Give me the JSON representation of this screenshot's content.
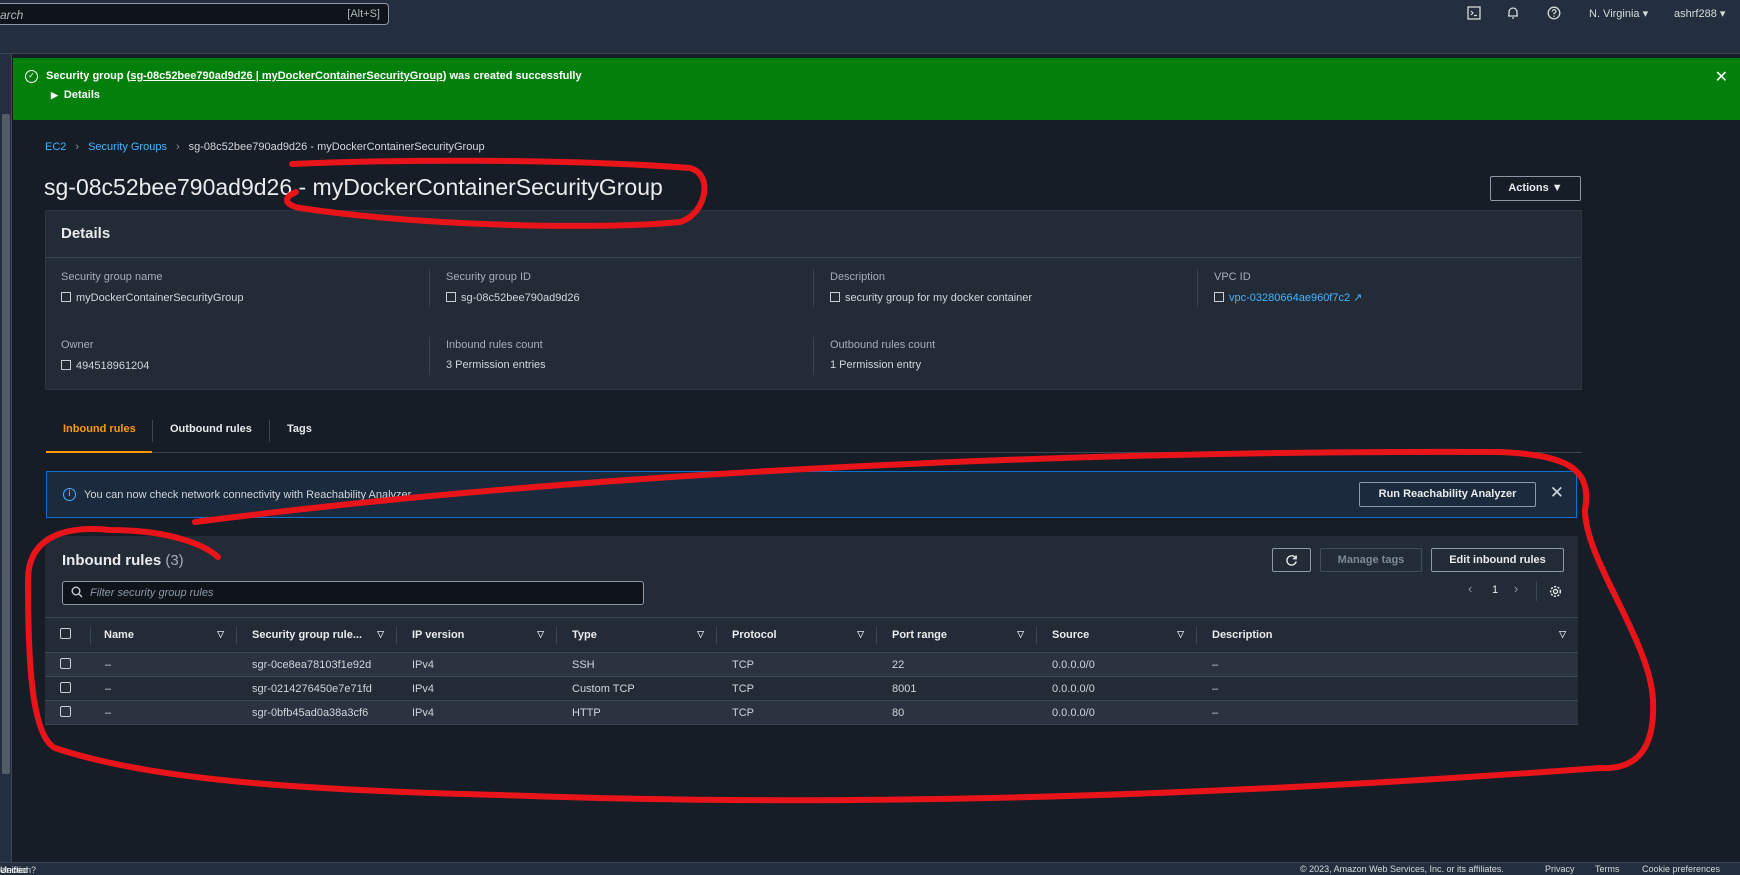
{
  "topnav": {
    "search_placeholder": "arch",
    "search_shortcut": "[Alt+S]",
    "region": "N. Virginia",
    "user": "ashrf288"
  },
  "flash": {
    "prefix": "Security group (",
    "link": "sg-08c52bee790ad9d26 | myDockerContainerSecurityGroup",
    "suffix": ") was created successfully",
    "details_label": "Details"
  },
  "breadcrumb": {
    "items": [
      "EC2",
      "Security Groups",
      "sg-08c52bee790ad9d26 - myDockerContainerSecurityGroup"
    ]
  },
  "page": {
    "title": "sg-08c52bee790ad9d26 - myDockerContainerSecurityGroup",
    "actions_label": "Actions"
  },
  "details": {
    "title": "Details",
    "fields": [
      {
        "label": "Security group name",
        "value": "myDockerContainerSecurityGroup"
      },
      {
        "label": "Security group ID",
        "value": "sg-08c52bee790ad9d26"
      },
      {
        "label": "Description",
        "value": "security group for my docker container"
      },
      {
        "label": "VPC ID",
        "value": "vpc-03280664ae960f7c2"
      },
      {
        "label": "Owner",
        "value": "494518961204"
      },
      {
        "label": "Inbound rules count",
        "value": "3 Permission entries"
      },
      {
        "label": "Outbound rules count",
        "value": "1 Permission entry"
      }
    ]
  },
  "tabs": [
    "Inbound rules",
    "Outbound rules",
    "Tags"
  ],
  "info_banner": {
    "text": "You can now check network connectivity with Reachability Analyzer",
    "button": "Run Reachability Analyzer"
  },
  "inbound": {
    "title": "Inbound rules",
    "count": "(3)",
    "manage_tags": "Manage tags",
    "edit": "Edit inbound rules",
    "filter_placeholder": "Filter security group rules",
    "page": "1",
    "columns": [
      "Name",
      "Security group rule...",
      "IP version",
      "Type",
      "Protocol",
      "Port range",
      "Source",
      "Description"
    ],
    "rows": [
      [
        "–",
        "sgr-0ce8ea78103f1e92d",
        "IPv4",
        "SSH",
        "TCP",
        "22",
        "0.0.0.0/0",
        "–"
      ],
      [
        "–",
        "sgr-0214276450e7e71fd",
        "IPv4",
        "Custom TCP",
        "TCP",
        "8001",
        "0.0.0.0/0",
        "–"
      ],
      [
        "–",
        "sgr-0bfb45ad0a38a3cf6",
        "IPv4",
        "HTTP",
        "TCP",
        "80",
        "0.0.0.0/0",
        "–"
      ]
    ]
  },
  "footer": {
    "left": "election? Find it in the new",
    "left_link": "Unified Settings",
    "copyright": "© 2023, Amazon Web Services, Inc. or its affiliates.",
    "links": [
      "Privacy",
      "Terms",
      "Cookie preferences"
    ]
  },
  "colors": {
    "success": "#037f0c",
    "link": "#42b4ff",
    "accent": "#ff9900",
    "annotation": "#e8141a"
  }
}
